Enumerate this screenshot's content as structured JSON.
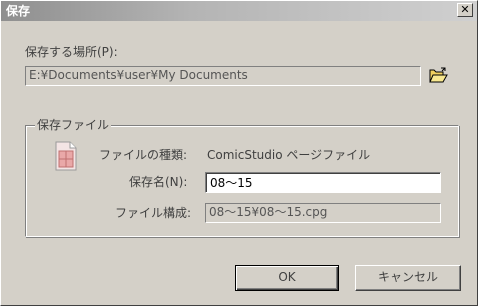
{
  "window": {
    "title": "保存",
    "close_label": "✕"
  },
  "location": {
    "label": "保存する場所(P):",
    "path": "E:¥Documents¥user¥My Documents",
    "folder_button_icon": "open-folder-icon"
  },
  "group": {
    "legend": "保存ファイル",
    "file_type_label": "ファイルの種類:",
    "file_type_value": "ComicStudio ページファイル",
    "save_name_label": "保存名(N):",
    "save_name_value": "08〜15",
    "file_structure_label": "ファイル構成:",
    "file_structure_value": "08〜15¥08〜15.cpg"
  },
  "buttons": {
    "ok": "OK",
    "cancel": "キャンセル"
  }
}
